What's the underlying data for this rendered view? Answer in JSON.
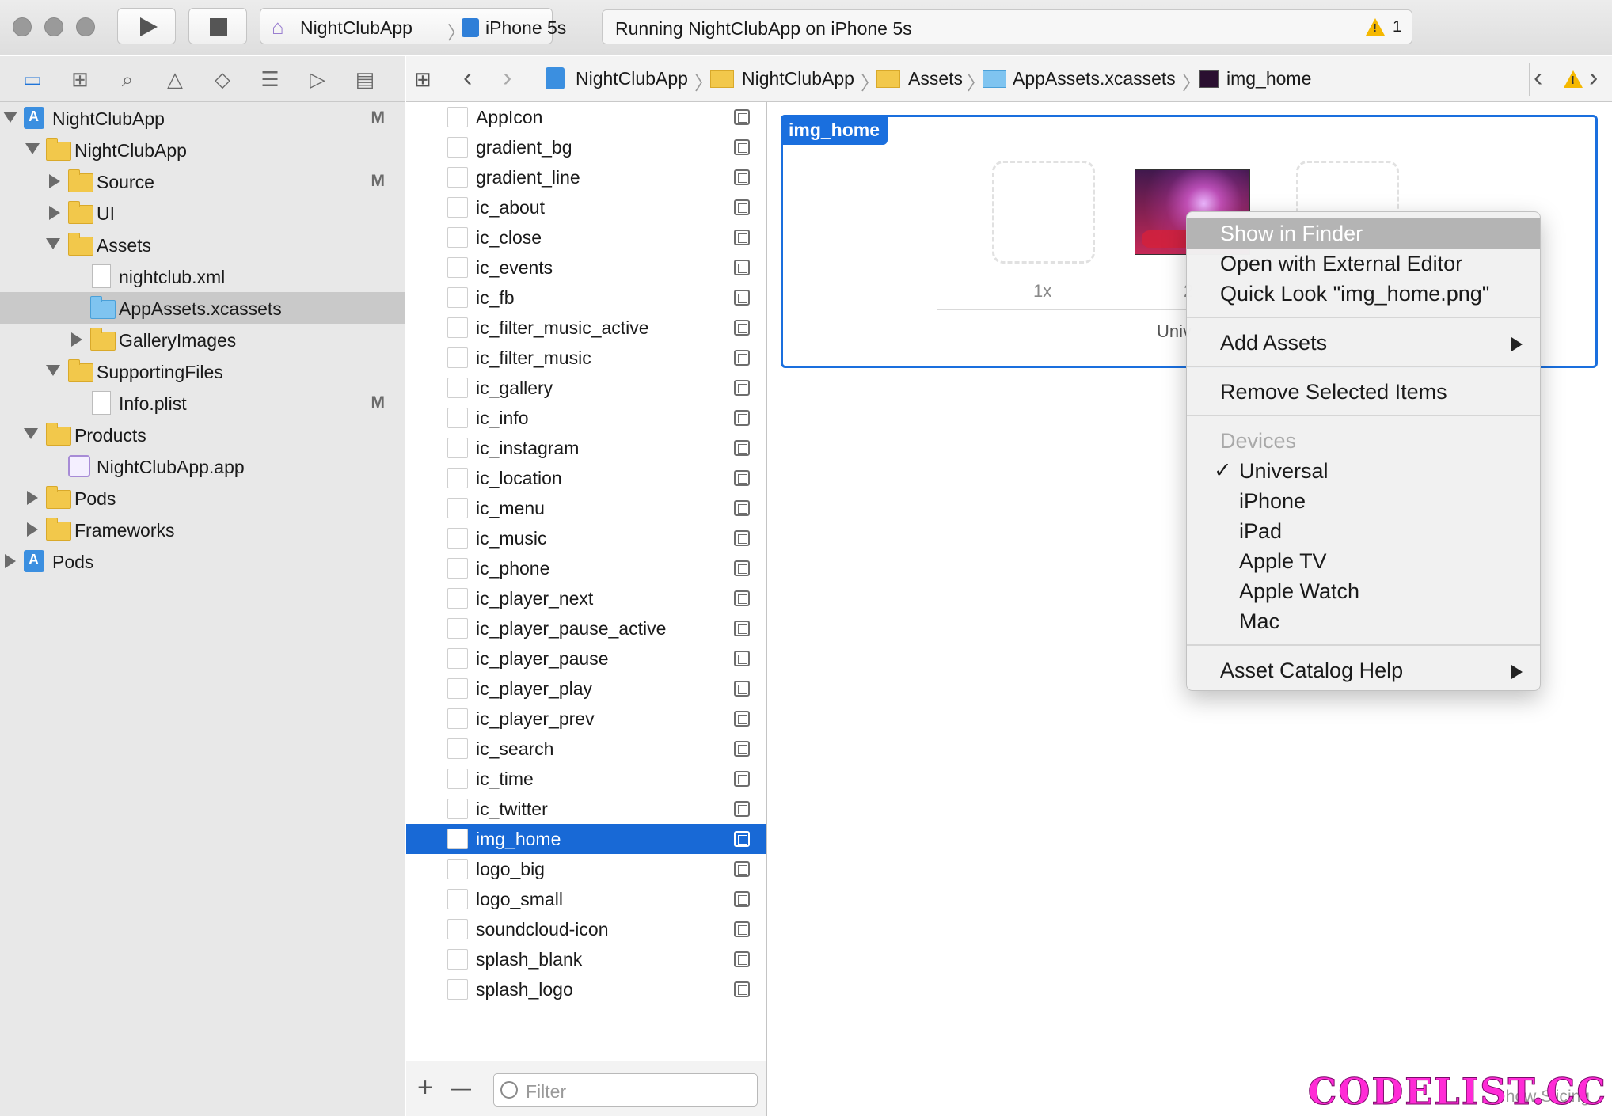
{
  "toolbar": {
    "scheme_name": "NightClubApp",
    "device": "iPhone 5s",
    "status": "Running NightClubApp on iPhone 5s",
    "warning_count": "1"
  },
  "navigator": {
    "tree": [
      {
        "label": "NightClubApp",
        "badge": "M"
      },
      {
        "label": "NightClubApp",
        "badge": ""
      },
      {
        "label": "Source",
        "badge": "M"
      },
      {
        "label": "UI",
        "badge": ""
      },
      {
        "label": "Assets",
        "badge": ""
      },
      {
        "label": "nightclub.xml",
        "badge": ""
      },
      {
        "label": "AppAssets.xcassets",
        "badge": ""
      },
      {
        "label": "GalleryImages",
        "badge": ""
      },
      {
        "label": "SupportingFiles",
        "badge": ""
      },
      {
        "label": "Info.plist",
        "badge": "M"
      },
      {
        "label": "Products",
        "badge": ""
      },
      {
        "label": "NightClubApp.app",
        "badge": ""
      },
      {
        "label": "Pods",
        "badge": ""
      },
      {
        "label": "Frameworks",
        "badge": ""
      },
      {
        "label": "Pods",
        "badge": ""
      }
    ]
  },
  "jumpbar": {
    "crumbs": [
      "NightClubApp",
      "NightClubApp",
      "Assets",
      "AppAssets.xcassets",
      "img_home"
    ]
  },
  "assets": {
    "items": [
      "AppIcon",
      "gradient_bg",
      "gradient_line",
      "ic_about",
      "ic_close",
      "ic_events",
      "ic_fb",
      "ic_filter_music_active",
      "ic_filter_music",
      "ic_gallery",
      "ic_info",
      "ic_instagram",
      "ic_location",
      "ic_menu",
      "ic_music",
      "ic_phone",
      "ic_player_next",
      "ic_player_pause_active",
      "ic_player_pause",
      "ic_player_play",
      "ic_player_prev",
      "ic_search",
      "ic_time",
      "ic_twitter",
      "img_home",
      "logo_big",
      "logo_small",
      "soundcloud-icon",
      "splash_blank",
      "splash_logo"
    ],
    "selected": "img_home",
    "filter_placeholder": "Filter",
    "add_label": "+",
    "remove_label": "—"
  },
  "editor": {
    "set_name": "img_home",
    "slot_1x": "1x",
    "slot_2x": "2",
    "universal_label": "Univ"
  },
  "context_menu": {
    "show_in_finder": "Show in Finder",
    "open_external": "Open with External Editor",
    "quick_look": "Quick Look \"img_home.png\"",
    "add_assets": "Add Assets",
    "remove_selected": "Remove Selected Items",
    "devices_header": "Devices",
    "check_mark": "✓",
    "devices": [
      "Universal",
      "iPhone",
      "iPad",
      "Apple TV",
      "Apple Watch",
      "Mac"
    ],
    "help": "Asset Catalog Help"
  },
  "footer": {
    "slicing": "how Slicing",
    "watermark": "CODELIST.CC"
  },
  "colors": {
    "selection_blue": "#1869d6",
    "set_border": "#1a6fde",
    "warning": "#f5b800",
    "watermark": "#ff2bd6"
  }
}
